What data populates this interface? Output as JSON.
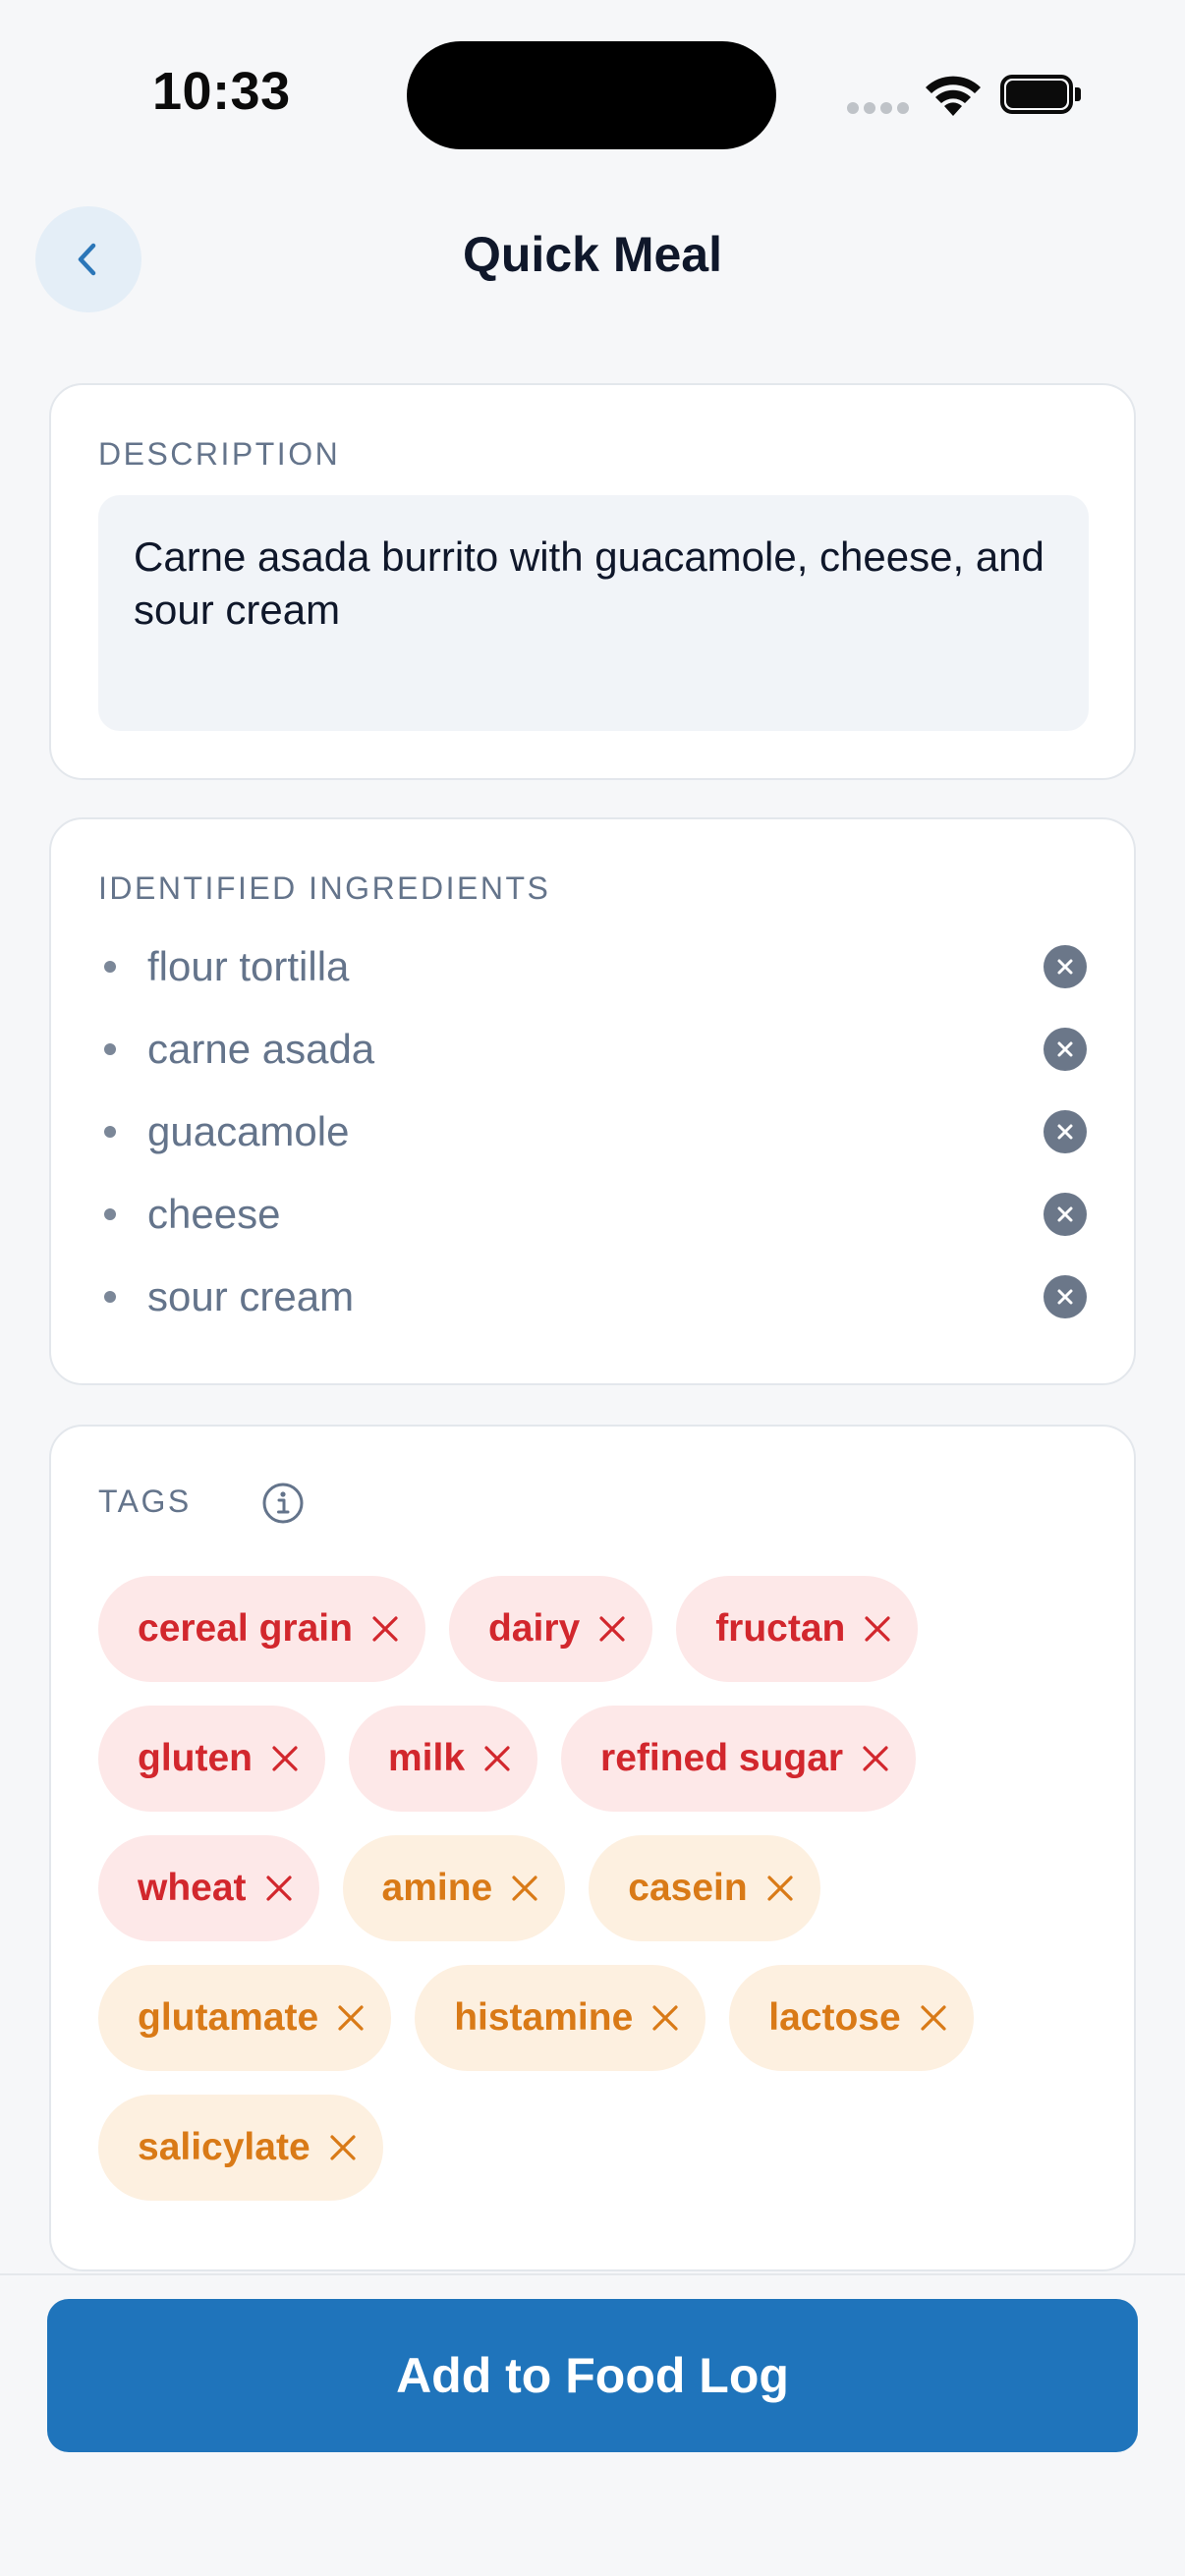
{
  "status_bar": {
    "time": "10:33"
  },
  "header": {
    "title": "Quick Meal",
    "back_icon": "chevron-left-icon"
  },
  "description": {
    "label": "DESCRIPTION",
    "value": "Carne asada burrito with guacamole, cheese, and sour cream"
  },
  "ingredients": {
    "label": "IDENTIFIED INGREDIENTS",
    "items": [
      {
        "label": "flour tortilla"
      },
      {
        "label": "carne asada"
      },
      {
        "label": "guacamole"
      },
      {
        "label": "cheese"
      },
      {
        "label": "sour cream"
      }
    ]
  },
  "tags": {
    "label": "TAGS",
    "items": [
      {
        "label": "cereal grain",
        "tone": "red"
      },
      {
        "label": "dairy",
        "tone": "red"
      },
      {
        "label": "fructan",
        "tone": "red"
      },
      {
        "label": "gluten",
        "tone": "red"
      },
      {
        "label": "milk",
        "tone": "red"
      },
      {
        "label": "refined sugar",
        "tone": "red"
      },
      {
        "label": "wheat",
        "tone": "red"
      },
      {
        "label": "amine",
        "tone": "orange"
      },
      {
        "label": "casein",
        "tone": "orange"
      },
      {
        "label": "glutamate",
        "tone": "orange"
      },
      {
        "label": "histamine",
        "tone": "orange"
      },
      {
        "label": "lactose",
        "tone": "orange"
      },
      {
        "label": "salicylate",
        "tone": "orange"
      }
    ]
  },
  "footer": {
    "add_button_label": "Add to Food Log"
  },
  "colors": {
    "accent": "#1f74bb",
    "tag_red_bg": "#fde8e8",
    "tag_red_text": "#d2272d",
    "tag_orange_bg": "#fdf0e0",
    "tag_orange_text": "#d97a17"
  }
}
